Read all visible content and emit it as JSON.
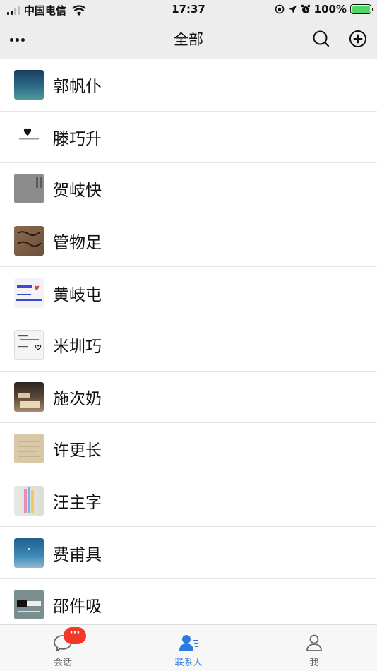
{
  "status_bar": {
    "carrier": "中国电信",
    "time": "17:37",
    "battery_percent": "100%"
  },
  "nav": {
    "title": "全部"
  },
  "contacts": [
    {
      "name": "郭帆仆"
    },
    {
      "name": "滕巧升"
    },
    {
      "name": "贺岐快"
    },
    {
      "name": "管物足"
    },
    {
      "name": "黄岐屯"
    },
    {
      "name": "米圳巧"
    },
    {
      "name": "施次奶"
    },
    {
      "name": "许更长"
    },
    {
      "name": "汪主字"
    },
    {
      "name": "费甫具"
    },
    {
      "name": "邵件吸"
    }
  ],
  "tabs": {
    "chat_label": "会话",
    "chat_badge": "···",
    "contacts_label": "联系人",
    "me_label": "我"
  },
  "colors": {
    "accent": "#2a7ae2",
    "badge": "#f0392b",
    "bar_bg": "#ededed"
  }
}
